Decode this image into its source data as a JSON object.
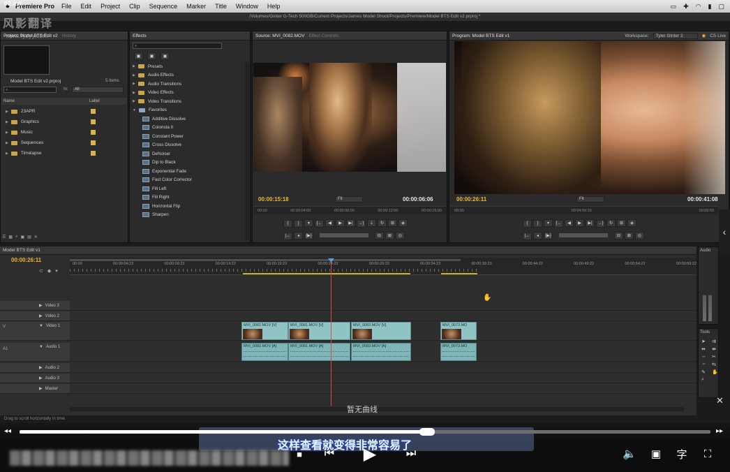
{
  "video_file": "02.avi",
  "menubar": {
    "app": "Premiere Pro",
    "items": [
      "File",
      "Edit",
      "Project",
      "Clip",
      "Sequence",
      "Marker",
      "Title",
      "Window",
      "Help"
    ]
  },
  "window_title": "/Volumes/Ginter G-Tech 500GB/Current Projects/James Model Shoot/Projects/Premiere/Model BTS Edit v2.prproj *",
  "workspace": {
    "label": "Workspace:",
    "value": "Tyler Ginter 2",
    "cs_live": "CS Live"
  },
  "watermark": {
    "text": "风影翻译",
    "url": "www.fyzyy.com"
  },
  "project": {
    "tabs": [
      "Project: Model BTS Edit v2",
      "History"
    ],
    "filename": "Model BTS Edit v2.prproj",
    "items_count": "5 Items",
    "in_label": "In:",
    "in_value": "All",
    "col_name": "Name",
    "col_label": "Label",
    "bins": [
      "23APR",
      "Graphics",
      "Music",
      "Sequences",
      "Timelapse"
    ]
  },
  "effects": {
    "tab": "Effects",
    "folders": [
      "Presets",
      "Audio Effects",
      "Audio Transitions",
      "Video Effects",
      "Video Transitions",
      "Favorites"
    ],
    "favorites": [
      "Additive Dissolve",
      "Colorista II",
      "Constant Power",
      "Cross Dissolve",
      "DeNoiser",
      "Dip to Black",
      "Exponential Fade",
      "Fast Color Corrector",
      "Fill Left",
      "Fill Right",
      "Horizontal Flip",
      "Sharpen"
    ]
  },
  "source": {
    "tabs": [
      "Source: MVI_0082.MOV",
      "Effect Controls"
    ],
    "timecode_in": "00:00:15:18",
    "zoom": "Fit",
    "duration": "00:00:06:06",
    "ruler": [
      "00:00",
      "00:00:04:00",
      "00:00:08:00",
      "00:00:12:00",
      "00:00:16:00"
    ]
  },
  "program": {
    "tab": "Program: Model BTS Edit v1",
    "timecode": "00:00:26:11",
    "zoom": "Fit",
    "duration": "00:00:41:08",
    "ruler": [
      "00:00",
      "00:04:59:16",
      "00:09:59"
    ]
  },
  "timeline": {
    "tab": "Model BTS Edit v1",
    "timecode": "00:00:26:11",
    "ruler": [
      "00:00",
      "00:00:04:23",
      "00:00:09:23",
      "00:00:14:23",
      "00:00:19:23",
      "00:00:24:23",
      "00:00:29:23",
      "00:00:34:23",
      "00:00:39:23",
      "00:00:44:22",
      "00:00:49:22",
      "00:00:54:22",
      "00:00:59:22"
    ],
    "video_tracks": [
      "Video 3",
      "Video 2",
      "Video 1"
    ],
    "audio_tracks": [
      "Audio 1",
      "Audio 2",
      "Audio 3",
      "Master"
    ],
    "track_marker_v": "V",
    "track_marker_a": "A1",
    "video_clips": [
      "MVI_0082.MOV [V]",
      "MVI_0081.MOV [V]",
      "MVI_0083.MOV [V]",
      "MVI_0073.MO"
    ],
    "audio_clips": [
      "MVI_0082.MOV [A]",
      "MVI_0081.MOV [A]",
      "MVI_0083.MOV [A]",
      "MVI_0073.MO"
    ],
    "no_curve": "暂无曲线",
    "status": "Drag to scroll horizontally in time."
  },
  "audio_panel": "Audio",
  "tools_panel": "Tools",
  "player": {
    "subtitle": "这样查看就变得非常容易了",
    "progress": 0.59,
    "sub_button": "字"
  }
}
